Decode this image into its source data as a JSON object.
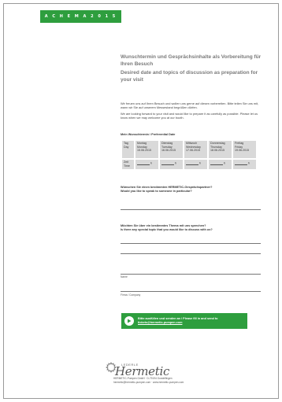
{
  "banner": "A C H E M A  2 0 1 5",
  "title_de": "Wunschtermin und Gesprächsinhalte als Vorbereitung für Ihren Besuch",
  "title_en": "Desired date and topics of discussion as preparation for your visit",
  "intro_de": "Wir freuen uns auf Ihren Besuch und wollen uns gerne auf diesen vorbereiten. Bitte teilen Sie uns mit, wann wir Sie auf unserem Messestand begrüßen dürfen.",
  "intro_en": "We are looking forward to your visit and would like to prepare it as carefully as possible. Please let us know when we may welcome you at our booth.",
  "date_label": "Mein Wunschtermin / Preferential Date",
  "table": {
    "day_head": [
      "Tag",
      "Day"
    ],
    "time_head": [
      "Zeit",
      "Time"
    ],
    "hour_suffix": "h",
    "days": [
      {
        "de": "Montag",
        "en": "Monday",
        "date": "15.06.2015"
      },
      {
        "de": "Dienstag",
        "en": "Tuesday",
        "date": "16.06.2015"
      },
      {
        "de": "Mittwoch",
        "en": "Wednesday",
        "date": "17.06.2015"
      },
      {
        "de": "Donnerstag",
        "en": "Thursday",
        "date": "18.06.2015"
      },
      {
        "de": "Freitag",
        "en": "Friday",
        "date": "19.06.2015"
      }
    ]
  },
  "question1_de": "Wünschen Sie einen bestimmten HERMETIC-Gesprächspartner?",
  "question1_en": "Would you like to speak to someone in particular?",
  "question2_de": "Möchten Sie über ein bestimmtes Thema mit uns sprechen?",
  "question2_en": "Is there any special topic that you would like to discuss with us?",
  "name_label": "Name",
  "company_label": "Firma / Company",
  "send_button": {
    "text": "Bitte ausfüllen und senden an / Please fill in and send to",
    "email": "tickets@hermetic-pumpen.com"
  },
  "logo": {
    "lederle": "LEDERLE",
    "hermetic": "Hermetic"
  },
  "address_line1": "HERMETIC-Pumpen GmbH · D-79194 Gundelfingen",
  "address_line2": "hermetic@hermetic-pumpen.com · www.hermetic-pumpen.com",
  "colors": {
    "accent": "#2e9e3e",
    "title": "#7a7a7a",
    "cell": "#d9d9d9"
  }
}
